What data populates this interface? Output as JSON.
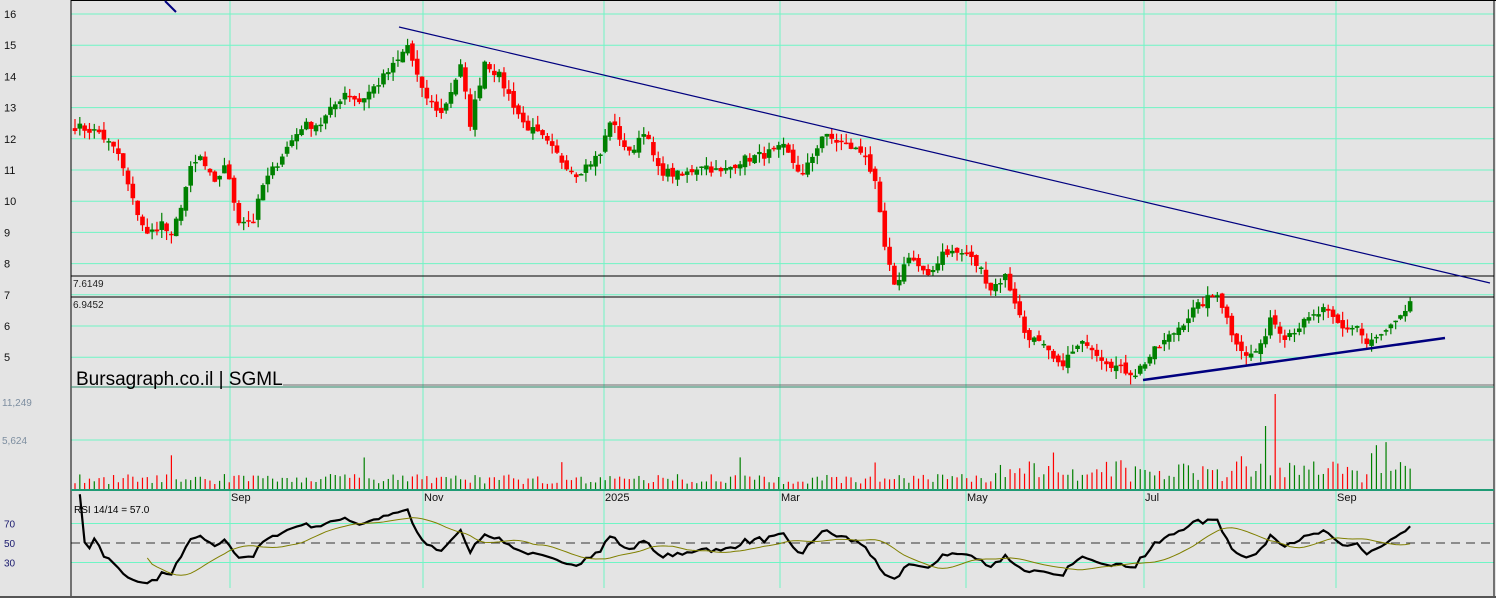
{
  "chart_data": {
    "type": "candlestick",
    "title": "Bursagraph.co.il | SGML",
    "watermark": "Bursagraph.co.il | SGML",
    "price_axis": {
      "ticks": [
        "16",
        "15",
        "14",
        "13",
        "12",
        "11",
        "10",
        "9",
        "8",
        "7",
        "6",
        "5"
      ],
      "ylim": [
        4.3,
        16.4
      ]
    },
    "volume_axis": {
      "ticks": [
        "11,249",
        "5,624"
      ]
    },
    "rsi_axis": {
      "ticks": [
        "70",
        "50",
        "30"
      ],
      "label": "RSI 14/14 = 57.0",
      "last": 57.0
    },
    "x_labels": [
      "Sep",
      "Nov",
      "2025",
      "Mar",
      "May",
      "Jul",
      "Sep"
    ],
    "levels": [
      {
        "label": "7.6149",
        "value": 7.6149
      },
      {
        "label": "6.9452",
        "value": 6.9452
      }
    ],
    "approx_close_path": [
      [
        0,
        12.4
      ],
      [
        5,
        12.2
      ],
      [
        9,
        11.5
      ],
      [
        12,
        10.0
      ],
      [
        15,
        8.9
      ],
      [
        18,
        9.3
      ],
      [
        20,
        8.8
      ],
      [
        24,
        11.0
      ],
      [
        26,
        11.4
      ],
      [
        29,
        10.5
      ],
      [
        31,
        11.2
      ],
      [
        34,
        9.4
      ],
      [
        37,
        9.4
      ],
      [
        39,
        10.5
      ],
      [
        43,
        11.5
      ],
      [
        47,
        12.4
      ],
      [
        51,
        12.5
      ],
      [
        56,
        13.5
      ],
      [
        59,
        13.2
      ],
      [
        63,
        13.8
      ],
      [
        67,
        14.5
      ],
      [
        69,
        15.0
      ],
      [
        72,
        13.5
      ],
      [
        76,
        12.8
      ],
      [
        80,
        14.3
      ],
      [
        82,
        12.5
      ],
      [
        85,
        14.5
      ],
      [
        88,
        14.0
      ],
      [
        93,
        12.5
      ],
      [
        97,
        12.0
      ],
      [
        101,
        11.3
      ],
      [
        104,
        10.9
      ],
      [
        109,
        11.5
      ],
      [
        111,
        12.6
      ],
      [
        115,
        11.5
      ],
      [
        118,
        12.3
      ],
      [
        121,
        11.0
      ],
      [
        126,
        10.8
      ],
      [
        130,
        11.2
      ],
      [
        134,
        10.9
      ],
      [
        138,
        11.3
      ],
      [
        143,
        11.5
      ],
      [
        147,
        11.7
      ],
      [
        151,
        10.8
      ],
      [
        155,
        12.1
      ],
      [
        160,
        11.8
      ],
      [
        164,
        11.5
      ],
      [
        166,
        10.5
      ],
      [
        168,
        8.5
      ],
      [
        170,
        7.2
      ],
      [
        173,
        8.3
      ],
      [
        177,
        7.5
      ],
      [
        180,
        8.4
      ],
      [
        185,
        8.3
      ],
      [
        188,
        7.8
      ],
      [
        190,
        7.2
      ],
      [
        193,
        7.6
      ],
      [
        195,
        6.8
      ],
      [
        197,
        5.8
      ],
      [
        201,
        5.3
      ],
      [
        204,
        4.7
      ],
      [
        208,
        5.3
      ],
      [
        210,
        5.5
      ],
      [
        213,
        5.0
      ],
      [
        217,
        4.6
      ],
      [
        220,
        4.5
      ],
      [
        224,
        5.2
      ],
      [
        228,
        5.8
      ],
      [
        232,
        6.5
      ],
      [
        237,
        7.1
      ],
      [
        240,
        5.8
      ],
      [
        243,
        5.0
      ],
      [
        246,
        5.3
      ],
      [
        248,
        6.3
      ],
      [
        251,
        5.7
      ],
      [
        255,
        6.1
      ],
      [
        259,
        6.5
      ],
      [
        263,
        5.9
      ],
      [
        266,
        6.0
      ],
      [
        268,
        5.4
      ],
      [
        272,
        5.8
      ],
      [
        275,
        6.2
      ],
      [
        277,
        6.8
      ]
    ],
    "trendlines": [
      {
        "name": "resistance",
        "from": [
          67,
          15.6
        ],
        "to": [
          295,
          7.4
        ]
      },
      {
        "name": "support",
        "from": [
          223,
          4.55
        ],
        "to": [
          286,
          5.9
        ]
      }
    ]
  },
  "colors": {
    "up": "#008000",
    "down": "#ff0000",
    "grid": "#6ff5c5",
    "trend": "#00007f",
    "rsi": "#000000",
    "rsi_signal": "#808000",
    "rsi_mid": "#e00000"
  }
}
